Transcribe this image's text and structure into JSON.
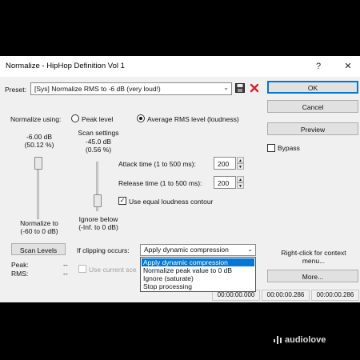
{
  "window": {
    "title": "Normalize - HipHop Definition Vol 1",
    "help_glyph": "?",
    "close_glyph": "✕"
  },
  "preset": {
    "label": "Preset:",
    "value": "[Sys] Normalize RMS to -6 dB (very loud!)",
    "arrow": "⌄"
  },
  "buttons": {
    "ok": "OK",
    "cancel": "Cancel",
    "preview": "Preview",
    "bypass": "Bypass",
    "scan_levels": "Scan Levels",
    "more": "More..."
  },
  "normalize": {
    "label": "Normalize using:",
    "peak_option": "Peak level",
    "rms_option": "Average RMS level (loudness)",
    "selected": "rms",
    "level_db": "-6.00 dB",
    "level_pct": "(50.12 %)",
    "slider_caption_1": "Normalize to",
    "slider_caption_2": "(-60 to 0 dB)"
  },
  "scan_settings": {
    "title": "Scan settings",
    "db": "-45.0 dB",
    "pct": "(0.56 %)",
    "slider_caption_1": "Ignore below",
    "slider_caption_2": "(-Inf. to 0 dB)"
  },
  "attack": {
    "label": "Attack time (1 to 500 ms):",
    "value": "200"
  },
  "release": {
    "label": "Release time (1 to 500 ms):",
    "value": "200"
  },
  "equal_loudness": {
    "label": "Use equal loudness contour",
    "checked": true,
    "mark": "✓"
  },
  "clipping": {
    "label": "If clipping occurs:",
    "value": "Apply dynamic compression",
    "arrow": "⌄",
    "options": [
      "Apply dynamic compression",
      "Normalize peak value to 0 dB",
      "Ignore (saturate)",
      "Stop processing"
    ],
    "selected_index": 0
  },
  "readouts": {
    "peak_label": "Peak:",
    "peak_value": "--",
    "rms_label": "RMS:",
    "rms_value": "--"
  },
  "use_current": {
    "label": "Use current sce",
    "enabled": false
  },
  "context_hint": {
    "line1": "Right-click for context",
    "line2": "menu..."
  },
  "statusbar": [
    "00:00:00.000",
    "00:00:00.286",
    "00:00:00.286"
  ],
  "watermark": "audiolove",
  "colors": {
    "accent": "#0078d7",
    "delete_red": "#d3262b",
    "dialog_bg": "#f0f0f0"
  }
}
